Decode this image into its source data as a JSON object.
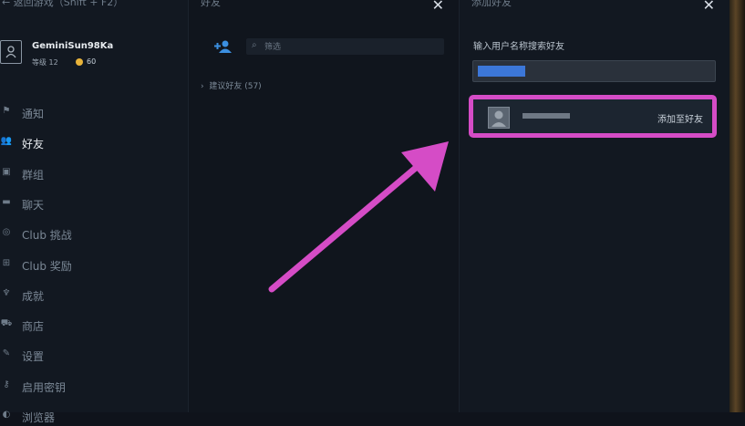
{
  "left": {
    "back_text": "← 返回游戏（Shift + F2）",
    "user": {
      "name": "GeminiSun98Ka",
      "level_label": "等级 12",
      "points": "60"
    },
    "nav": [
      {
        "icon": "bell-icon",
        "glyph": "⚑",
        "label": "通知"
      },
      {
        "icon": "friends-icon",
        "glyph": "👥",
        "label": "好友",
        "active": true
      },
      {
        "icon": "groups-icon",
        "glyph": "▣",
        "label": "群组"
      },
      {
        "icon": "chat-icon",
        "glyph": "▬",
        "label": "聊天"
      },
      {
        "icon": "club-challenge-icon",
        "glyph": "◎",
        "label": "Club 挑战"
      },
      {
        "icon": "club-reward-icon",
        "glyph": "⊞",
        "label": "Club 奖励"
      },
      {
        "icon": "trophy-icon",
        "glyph": "♆",
        "label": "成就"
      },
      {
        "icon": "store-icon",
        "glyph": "⛟",
        "label": "商店"
      },
      {
        "icon": "wrench-icon",
        "glyph": "✎",
        "label": "设置"
      },
      {
        "icon": "key-icon",
        "glyph": "⚷",
        "label": "启用密钥"
      },
      {
        "icon": "browser-icon",
        "glyph": "◐",
        "label": "浏览器"
      }
    ]
  },
  "middle": {
    "title": "好友",
    "filter_placeholder": "筛选",
    "suggested_label": "建议好友 (57)",
    "suggested_chevron": "›"
  },
  "right": {
    "title": "添加好友",
    "search_label": "输入用户名称搜索好友",
    "add_label": "添加至好友"
  },
  "colors": {
    "highlight": "#d54cc6",
    "accent_blue": "#3c77d8",
    "coin": "#e8b33a"
  }
}
